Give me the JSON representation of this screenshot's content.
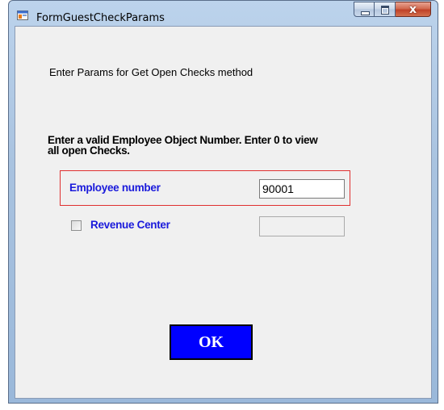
{
  "window": {
    "title": "FormGuestCheckParams",
    "controls": [
      "minimize-icon",
      "maximize-icon",
      "close-icon"
    ],
    "close_glyph": "x"
  },
  "form": {
    "intro_text": "Enter Params for Get Open Checks method",
    "instruction_line1": "Enter a valid Employee Object Number. Enter 0 to view",
    "instruction_line2": "all open Checks.",
    "employee_label": "Employee number",
    "employee_value": "90001",
    "revenue_center_label": "Revenue Center",
    "revenue_center_checked": false,
    "revenue_center_value": "",
    "ok_label": "OK"
  },
  "colors": {
    "label_blue": "#1a1adb",
    "ok_button_bg": "#0000ff",
    "ok_button_text": "#ffffff",
    "highlight_border": "#e03030",
    "client_bg": "#f0f0f0"
  }
}
